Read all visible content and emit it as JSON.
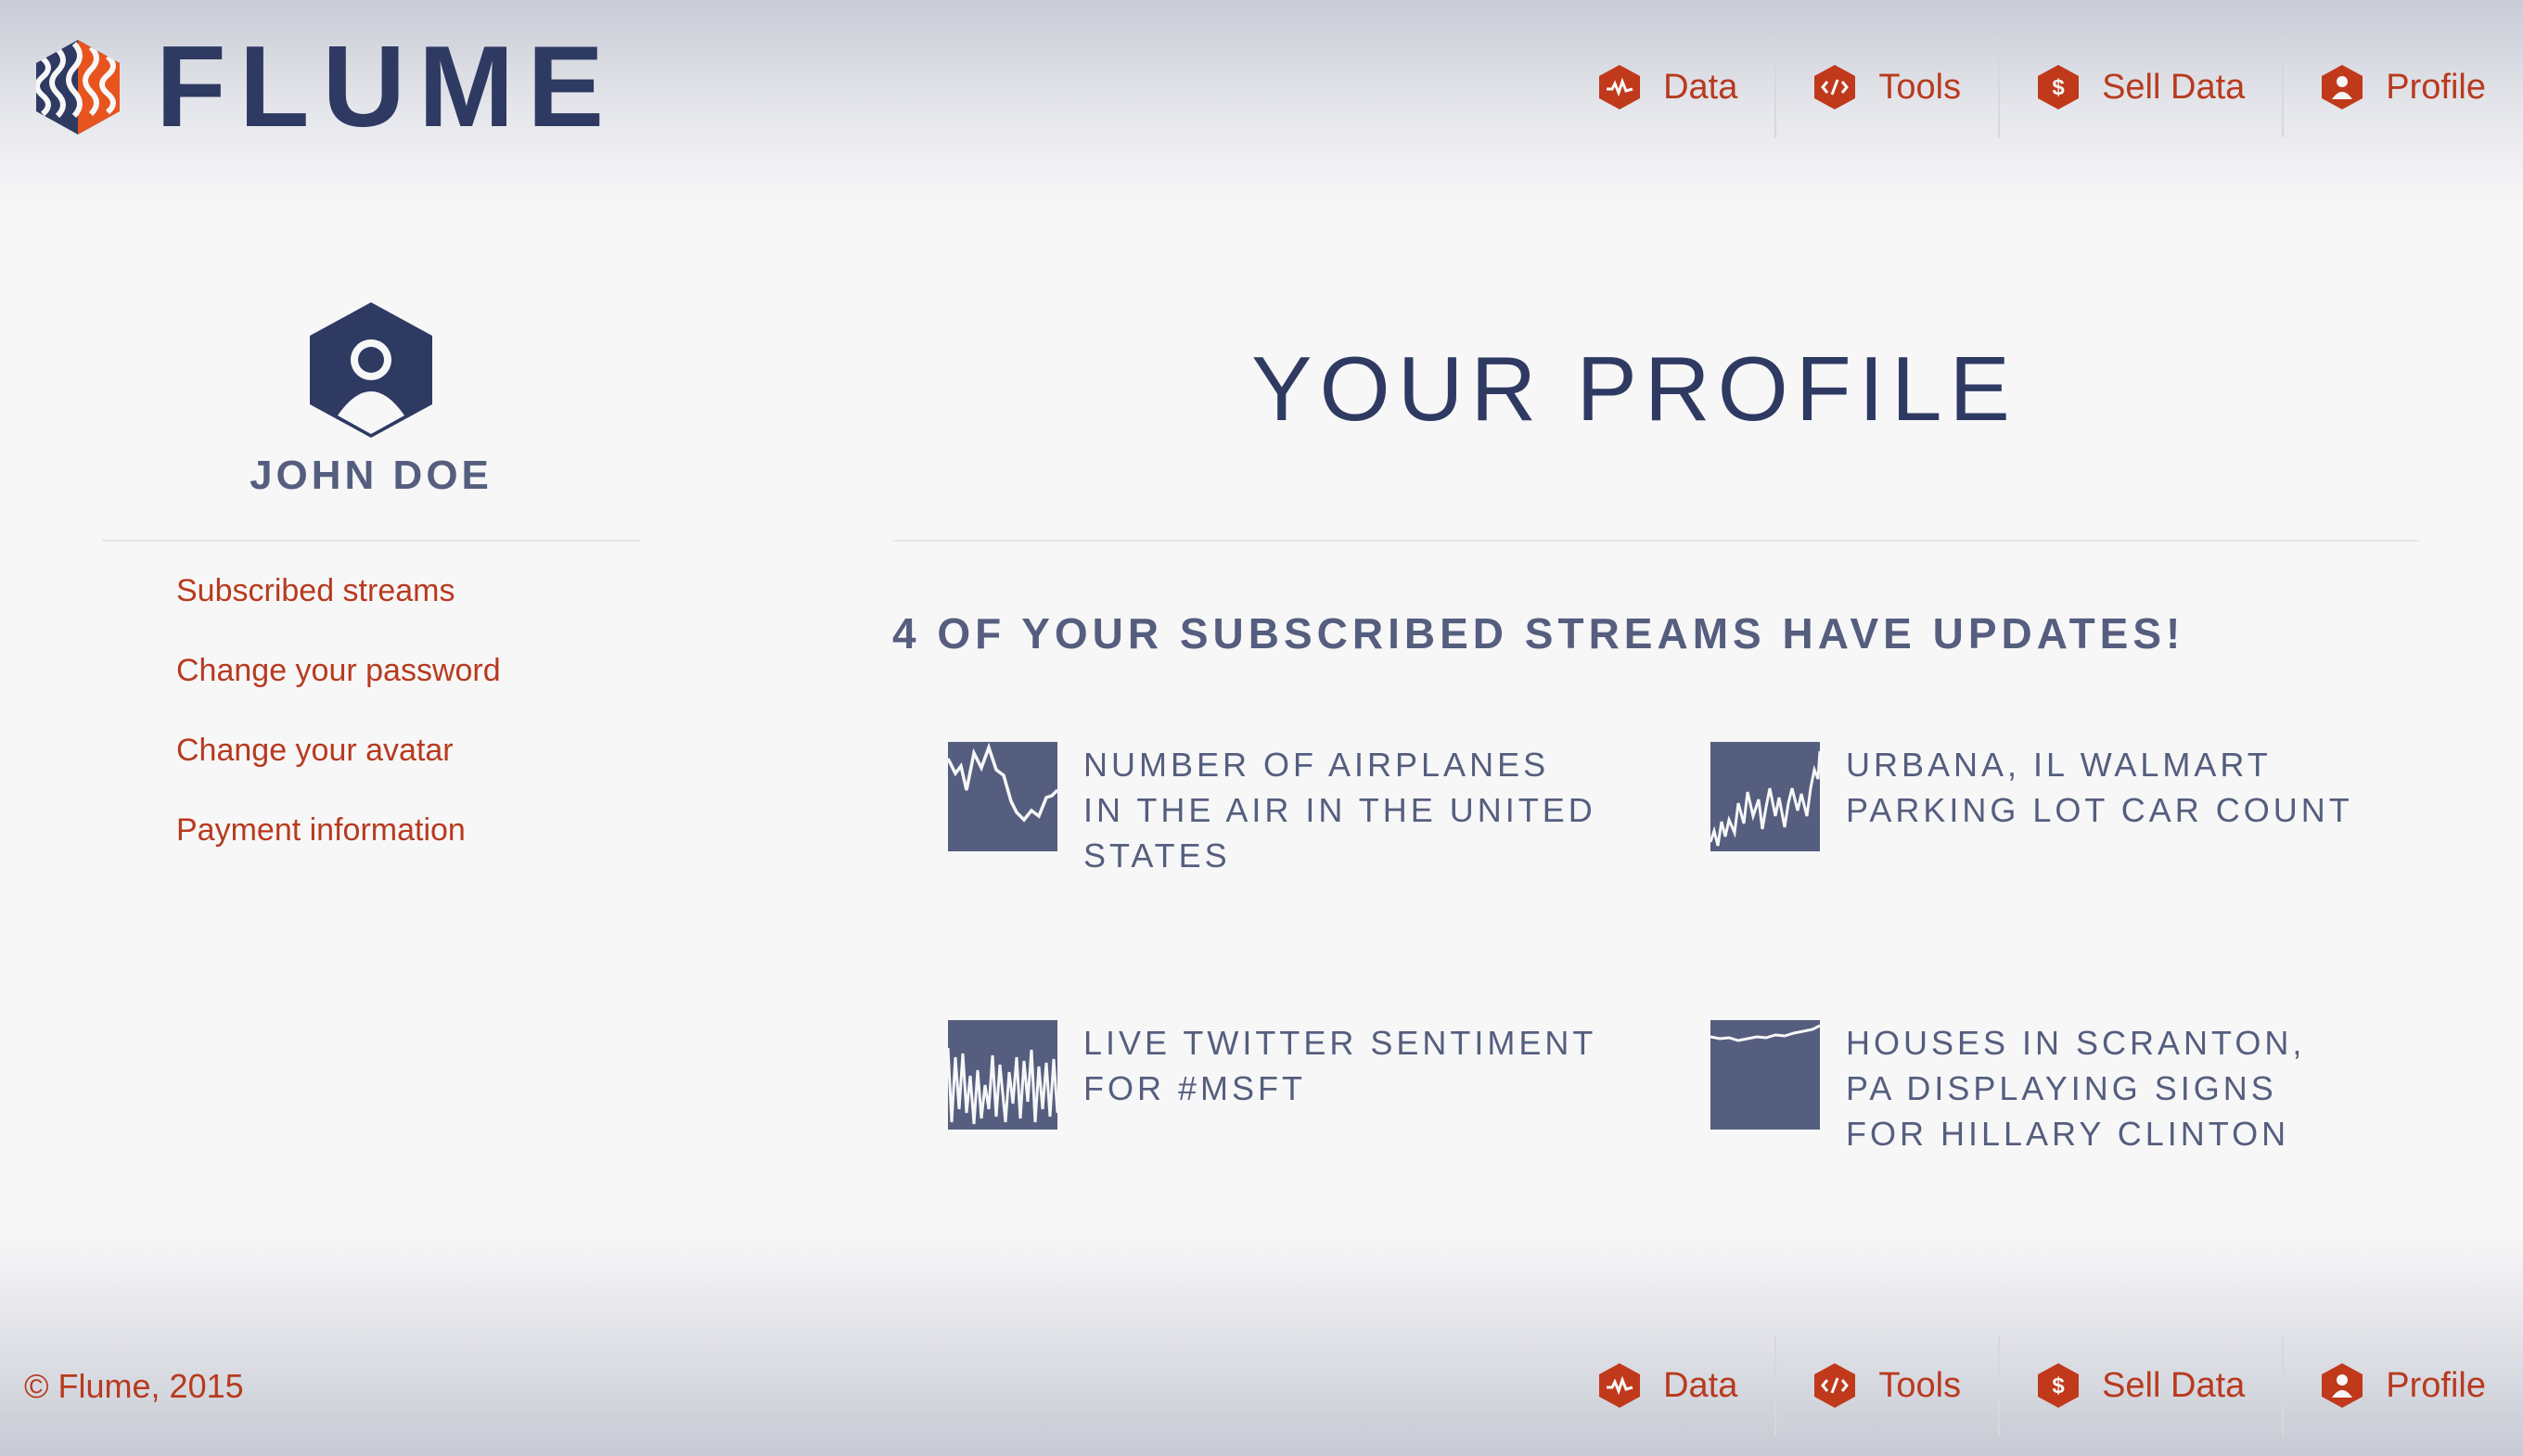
{
  "brand": {
    "name": "FLUME"
  },
  "nav": {
    "items": [
      {
        "label": "Data",
        "icon": "chart-hex-icon"
      },
      {
        "label": "Tools",
        "icon": "code-hex-icon"
      },
      {
        "label": "Sell Data",
        "icon": "dollar-hex-icon"
      },
      {
        "label": "Profile",
        "icon": "user-hex-icon"
      }
    ]
  },
  "sidebar": {
    "user_name": "JOHN DOE",
    "links": [
      "Subscribed streams",
      "Change your password",
      "Change your avatar",
      "Payment information"
    ]
  },
  "main": {
    "title": "YOUR PROFILE",
    "updates_heading": "4 OF YOUR SUBSCRIBED STREAMS HAVE UPDATES!",
    "streams": [
      {
        "title": "NUMBER OF AIRPLANES IN THE AIR IN THE UNITED STATES"
      },
      {
        "title": "URBANA, IL WALMART PARKING LOT CAR COUNT"
      },
      {
        "title": "LIVE TWITTER SENTIMENT FOR #MSFT"
      },
      {
        "title": "HOUSES IN SCRANTON, PA DISPLAYING SIGNS FOR HILLARY CLINTON"
      }
    ]
  },
  "footer": {
    "copyright": "© Flume, 2015"
  },
  "colors": {
    "accent": "#b83a1e",
    "brand_navy": "#2f3a63",
    "slate": "#555e7e",
    "logo_orange": "#e8541e"
  }
}
